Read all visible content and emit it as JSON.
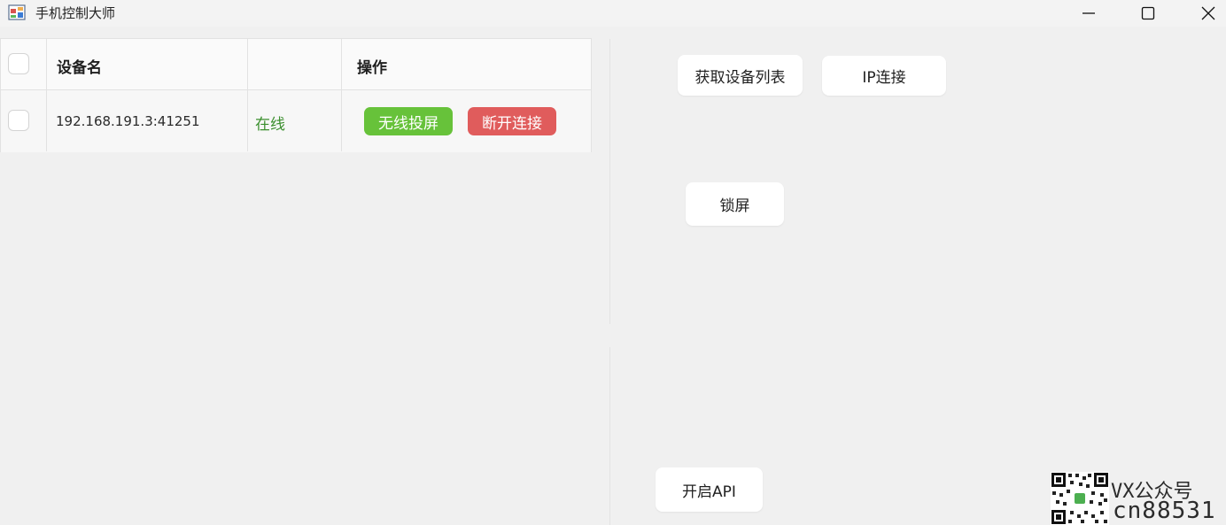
{
  "window": {
    "title": "手机控制大师",
    "icon": "app-window-icon",
    "controls": [
      "minimize-icon",
      "maximize-icon",
      "close-icon"
    ]
  },
  "table": {
    "headers": {
      "device_name": "设备名",
      "status": "",
      "actions": "操作"
    },
    "rows": [
      {
        "device": "192.168.191.3:41251",
        "status": "在线",
        "cast_button": "无线投屏",
        "disconnect_button": "断开连接"
      }
    ]
  },
  "panel": {
    "get_devices": "获取设备列表",
    "ip_connect": "IP连接",
    "lock_screen": "锁屏",
    "open_api": "开启API"
  },
  "watermark": {
    "line1": "VX公众号",
    "line2": "cn88531"
  },
  "colors": {
    "cast": "#67c23a",
    "disconnect": "#e05c5c",
    "online": "#3b8f2e"
  }
}
